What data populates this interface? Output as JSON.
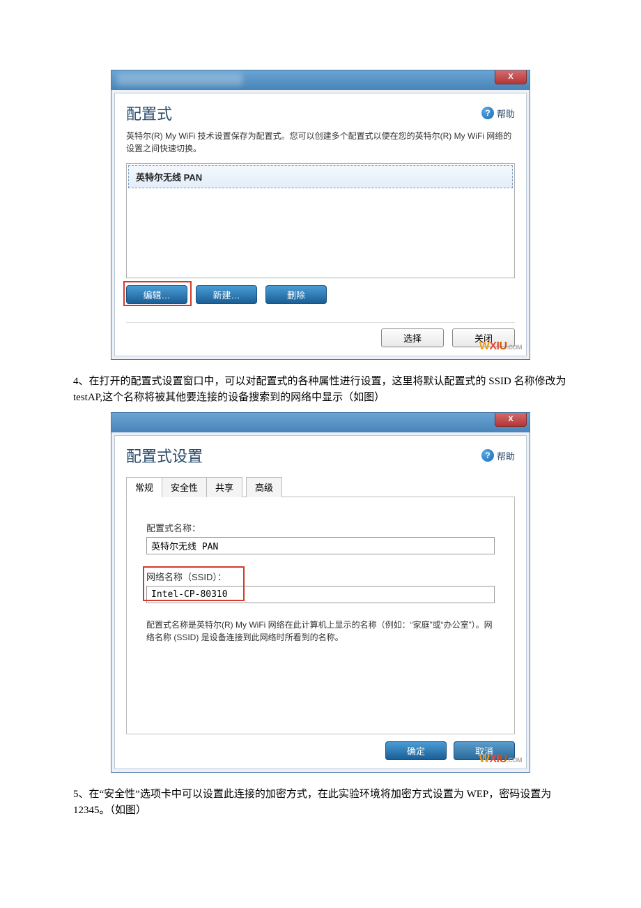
{
  "article": {
    "p1": "4、在打开的配置式设置窗口中，可以对配置式的各种属性进行设置，这里将默认配置式的 SSID 名称修改为 testAP,这个名称将被其他要连接的设备搜索到的网络中显示（如图）",
    "p2": "5、在“安全性”选项卡中可以设置此连接的加密方式，在此实验环境将加密方式设置为 WEP，密码设置为 12345。（如图）"
  },
  "win1": {
    "close": "X",
    "title": "配置式",
    "help": "帮助",
    "desc": "英特尔(R) My WiFi 技术设置保存为配置式。您可以创建多个配置式以便在您的英特尔(R) My WiFi 网络的设置之间快速切换。",
    "list_item": "英特尔无线 PAN",
    "btn_edit": "编辑…",
    "btn_new": "新建…",
    "btn_delete": "删除",
    "btn_select": "选择",
    "btn_close": "关闭"
  },
  "win2": {
    "close": "X",
    "title": "配置式设置",
    "help": "帮助",
    "tabs": {
      "general": "常规",
      "security": "安全性",
      "share": "共享",
      "advanced": "高级"
    },
    "field1_label": "配置式名称：",
    "field1_value": "英特尔无线 PAN",
    "field2_label": "网络名称（SSID）：",
    "field2_value": "Intel-CP-80310",
    "explain": "配置式名称是英特尔(R) My WiFi 网络在此计算机上显示的名称（例如：“家庭”或“办公室”）。网络名称 (SSID) 是设备连接到此网络时所看到的名称。",
    "btn_ok": "确定",
    "btn_cancel": "取消"
  },
  "watermark": {
    "w": "W",
    "x": "X",
    "i": "I",
    "u": "U",
    "com": ".COM"
  }
}
